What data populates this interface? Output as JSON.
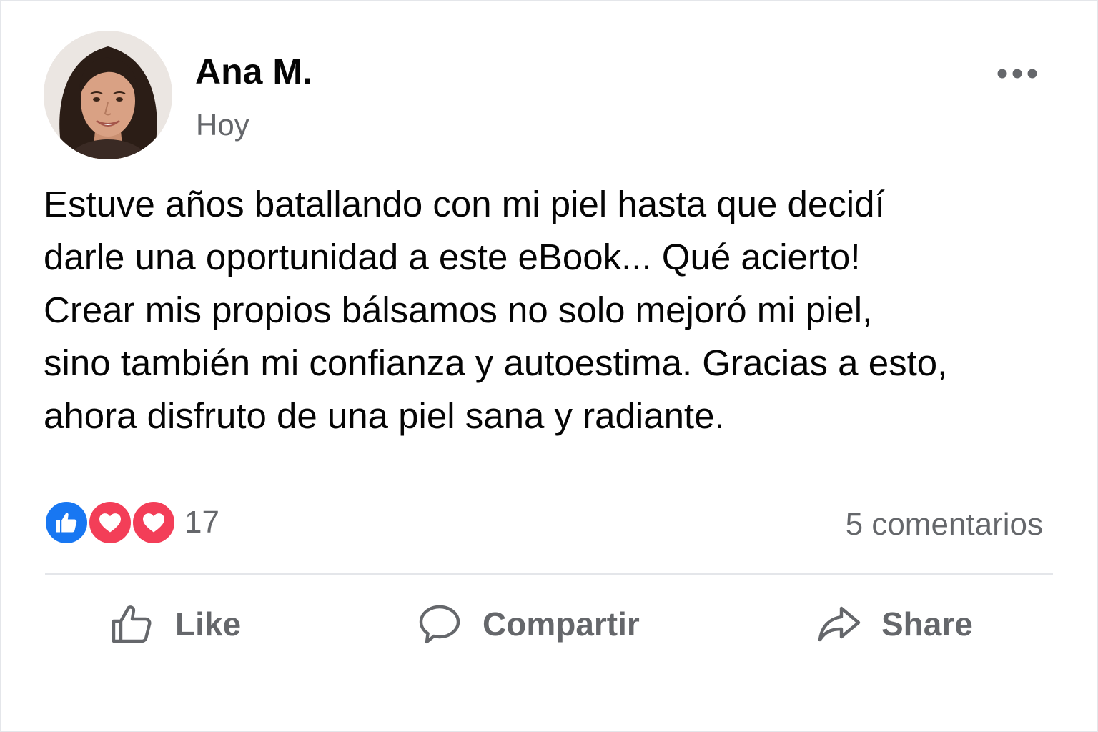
{
  "post": {
    "author": "Ana M.",
    "time": "Hoy",
    "text_lines": [
      "Estuve años batallando con mi piel hasta que decidí",
      "darle una oportunidad a este eBook... Qué acierto!",
      "Crear mis propios bálsamos no solo mejoró mi piel,",
      "sino también mi confianza y autoestima. Gracias a esto,",
      "ahora disfruto de una piel sana y radiante."
    ]
  },
  "reactions": {
    "icons": [
      "like-icon",
      "love-icon",
      "love-icon"
    ],
    "count": "17",
    "comments": "5 comentarios"
  },
  "actions": {
    "like": "Like",
    "comment": "Compartir",
    "share": "Share"
  },
  "colors": {
    "like_blue": "#1877f2",
    "love_red": "#f33e58",
    "secondary_text": "#65676b",
    "primary_text": "#050505"
  }
}
